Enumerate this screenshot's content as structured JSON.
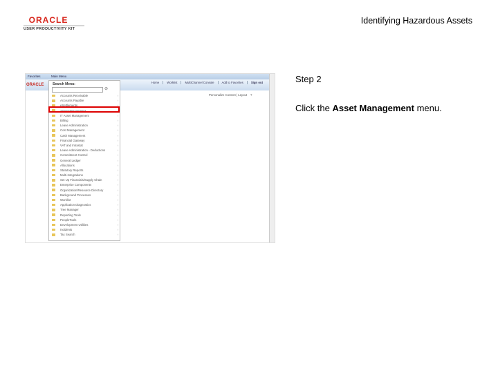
{
  "header": {
    "logo_text": "ORACLE",
    "logo_sub": "USER PRODUCTIVITY KIT",
    "title": "Identifying Hazardous Assets"
  },
  "screenshot": {
    "tabs": [
      "Favorites",
      "Main Menu"
    ],
    "brand": "ORACLE",
    "nav": [
      "Home",
      "Worklist",
      "MultiChannel Console",
      "Add to Favorites",
      "Sign out"
    ],
    "personalize": "Personalize Content | Layout",
    "help": "?",
    "menu": {
      "label": "Search Menu:",
      "go_icon": "arrow-circle-icon",
      "items": [
        "Accounts Receivable",
        "Accounts Payable",
        "eSettlements",
        "Asset Management",
        "IT Asset Management",
        "Billing",
        "Lease Administration",
        "Cost Management",
        "Cash Management",
        "Financial Gateway",
        "VAT and Intrastat",
        "Lease Administration - Deductions",
        "Commitment Control",
        "General Ledger",
        "Allocations",
        "Statutory Reports",
        "Multi-Integrations",
        "Set Up Financials/Supply Chain",
        "Enterprise Components",
        "Organization/Resource Directory",
        "Background Processes",
        "Worklist",
        "Application Diagnostics",
        "Tree Manager",
        "Reporting Tools",
        "PeopleTools",
        "Development Utilities",
        "Incidents",
        "Tax Search"
      ]
    }
  },
  "step": {
    "label": "Step 2",
    "instruction_prefix": "Click the ",
    "instruction_bold": "Asset Management",
    "instruction_suffix": " menu."
  }
}
